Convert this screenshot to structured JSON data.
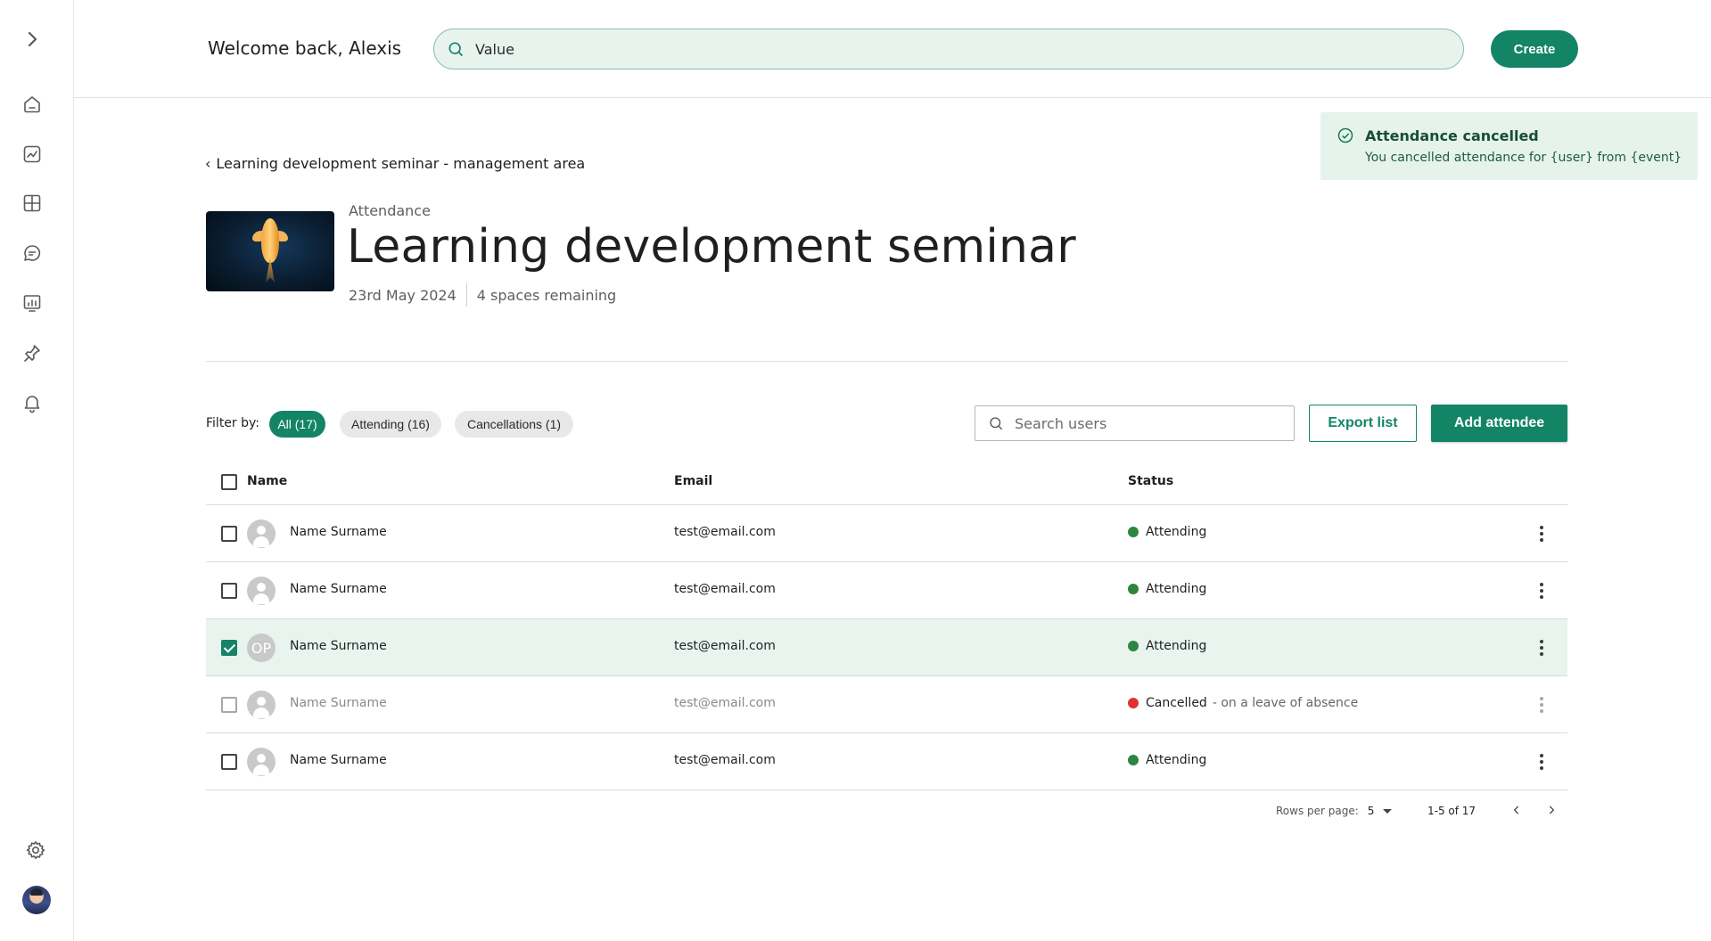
{
  "sidebar": {
    "items": [
      {
        "name": "expand",
        "icon": "chevron-right-icon"
      },
      {
        "name": "home",
        "icon": "home-icon"
      },
      {
        "name": "analytics",
        "icon": "chart-icon"
      },
      {
        "name": "layout",
        "icon": "grid-icon"
      },
      {
        "name": "messages",
        "icon": "chat-icon"
      },
      {
        "name": "reports",
        "icon": "report-icon"
      },
      {
        "name": "pinned",
        "icon": "pin-icon"
      },
      {
        "name": "notifications",
        "icon": "bell-icon"
      },
      {
        "name": "settings",
        "icon": "gear-icon"
      }
    ]
  },
  "header": {
    "welcome": "Welcome back, Alexis",
    "search_value": "Value",
    "create_label": "Create"
  },
  "toast": {
    "title": "Attendance cancelled",
    "message": "You cancelled attendance for {user} from {event}"
  },
  "breadcrumb": {
    "label": "Learning development seminar - management area"
  },
  "event": {
    "overline": "Attendance",
    "title": "Learning development seminar",
    "date": "23rd May 2024",
    "spaces": "4 spaces remaining"
  },
  "filters": {
    "label": "Filter by:",
    "chips": [
      {
        "label": "All (17)",
        "active": true
      },
      {
        "label": "Attending (16)",
        "active": false
      },
      {
        "label": "Cancellations (1)",
        "active": false
      }
    ]
  },
  "actions": {
    "search_placeholder": "Search users",
    "export_label": "Export list",
    "add_label": "Add attendee"
  },
  "table": {
    "columns": [
      "Name",
      "Email",
      "Status"
    ],
    "rows": [
      {
        "name": "Name Surname",
        "email": "test@email.com",
        "status": "Attending",
        "note": "",
        "checked": false,
        "initials": ""
      },
      {
        "name": "Name Surname",
        "email": "test@email.com",
        "status": "Attending",
        "note": "",
        "checked": false,
        "initials": ""
      },
      {
        "name": "Name Surname",
        "email": "test@email.com",
        "status": "Attending",
        "note": "",
        "checked": true,
        "initials": "OP"
      },
      {
        "name": "Name Surname",
        "email": "test@email.com",
        "status": "Cancelled",
        "note": "- on a leave of absence",
        "checked": false,
        "initials": ""
      },
      {
        "name": "Name Surname",
        "email": "test@email.com",
        "status": "Attending",
        "note": "",
        "checked": false,
        "initials": ""
      }
    ]
  },
  "pagination": {
    "rows_label": "Rows per page:",
    "rows_value": "5",
    "range": "1-5 of 17"
  },
  "colors": {
    "accent": "#138466",
    "attending": "#2e8540",
    "cancelled": "#e03131",
    "selected_row": "#e9f4ef",
    "toast_bg": "#e6f3ec"
  }
}
